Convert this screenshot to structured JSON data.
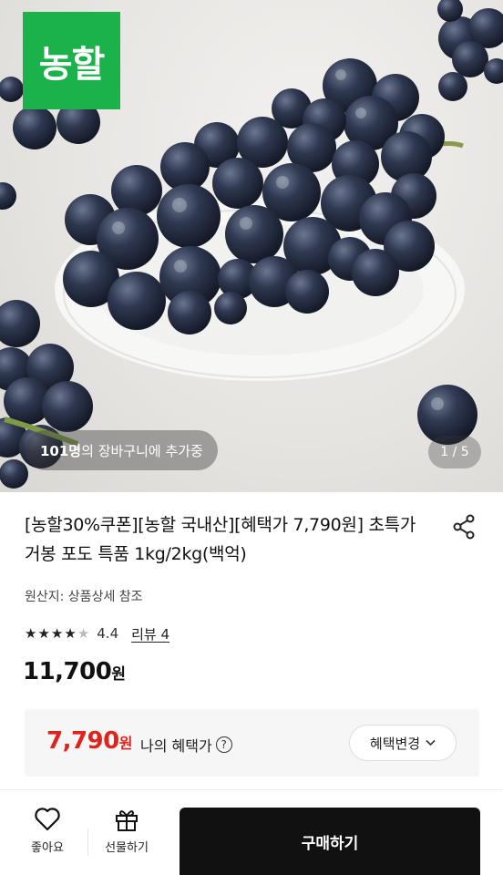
{
  "hero": {
    "brand_logo_text": "농할",
    "cart_count": "101명",
    "cart_text": "의 장바구니에 추가중",
    "pager": "1 / 5"
  },
  "product": {
    "title": "[농할30%쿠폰][농할 국내산][혜택가 7,790원] 초특가 거봉 포도 특품 1kg/2kg(백억)",
    "origin": "원산지: 상품상세 참조",
    "rating": "4.4",
    "rating_fraction": 0.88,
    "review_label": "리뷰 4",
    "price": "11,700",
    "price_unit": "원"
  },
  "benefit": {
    "price": "7,790",
    "price_unit": "원",
    "label": "나의 혜택가",
    "change_label": "혜택변경"
  },
  "bottom": {
    "like_label": "좋아요",
    "gift_label": "선물하기",
    "buy_label": "구매하기"
  },
  "colors": {
    "brand_green": "#1bb24b",
    "benefit_red": "#e0231d",
    "buy_button": "#111111"
  },
  "icons": [
    "share-icon",
    "star-icon",
    "help-icon",
    "chevron-down-icon",
    "heart-icon",
    "gift-icon"
  ]
}
